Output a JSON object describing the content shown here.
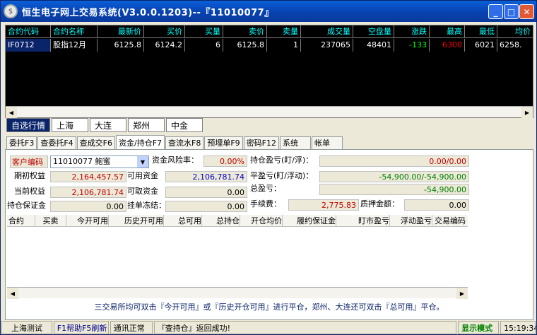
{
  "window": {
    "title": "恒生电子网上交易系统(V3.0.0.1203)--『11010077』",
    "minimize_glyph": "_",
    "maximize_glyph": "□",
    "close_glyph": "✕"
  },
  "quotes": {
    "headers": [
      "合约代码",
      "合约名称",
      "最新价",
      "买价",
      "买量",
      "卖价",
      "卖量",
      "成交量",
      "空盘量",
      "涨跌",
      "最高",
      "最低",
      "均价"
    ],
    "rows": [
      {
        "code": "IF0712",
        "name": "股指12月",
        "last": "6125.8",
        "bid": "6124.2",
        "bid_vol": "6",
        "ask": "6125.8",
        "ask_vol": "1",
        "volume": "237065",
        "open_interest": "48401",
        "change": "-133",
        "high": "6300",
        "low": "6021",
        "avg": "6258."
      }
    ]
  },
  "market_tabs": [
    "自选行情",
    "上海",
    "大连",
    "郑州",
    "中金"
  ],
  "function_tabs": [
    "委托F3",
    "查委托F4",
    "查成交F6",
    "资金/持仓F7",
    "查流水F8",
    "预埋单F9",
    "密码F12",
    "系统",
    "帐单"
  ],
  "account": {
    "client_code_label": "客户编码",
    "client_code_value": "11010077 鲍蜜",
    "risk_label": "资金风险率：",
    "risk_value": "0.00%",
    "open_pnl_label": "持仓盈亏(盯/浮)：",
    "open_pnl_value": "0.00/0.00",
    "initial_equity_label": "期初权益",
    "initial_equity_value": "2,164,457.57",
    "available_funds_label": "可用资金",
    "available_funds_value": "2,106,781.74",
    "close_pnl_label": "平盈亏(盯/浮动)：",
    "close_pnl_value": "-54,900.00/-54,900.00",
    "current_equity_label": "当前权益",
    "current_equity_value": "2,106,781.74",
    "withdrawable_label": "可取资金",
    "withdrawable_value": "0.00",
    "total_pnl_label": "总盈亏：",
    "total_pnl_value": "-54,900.00",
    "margin_label": "持仓保证金",
    "margin_value": "0.00",
    "frozen_label": "挂单冻结：",
    "frozen_value": "0.00",
    "fee_label": "手续费：",
    "fee_value": "2,775.83",
    "pledge_label": "质押金额：",
    "pledge_value": "0.00"
  },
  "positions_table": {
    "headers": [
      "合约",
      "买卖",
      "今开可用",
      "历史开可用",
      "总可用",
      "总持仓",
      "开仓均价",
      "履约保证金",
      "盯市盈亏",
      "浮动盈亏",
      "交易编码"
    ]
  },
  "hint": "三交易所均可双击『今开可用』或『历史开仓可用』进行平仓，郑州、大连还可双击『总可用』平仓。",
  "status_bar": {
    "server": "上海测试",
    "help": "F1帮助F5刷新",
    "comm": "通讯正常",
    "message": "『查持仓』返回成功!",
    "mode": "显示模式",
    "time": "15:19:34"
  },
  "colors": {
    "header_cyan": "#00ffff",
    "down_red": "#ff0000",
    "up_green": "#00ff00",
    "mode_green": "#008000"
  }
}
